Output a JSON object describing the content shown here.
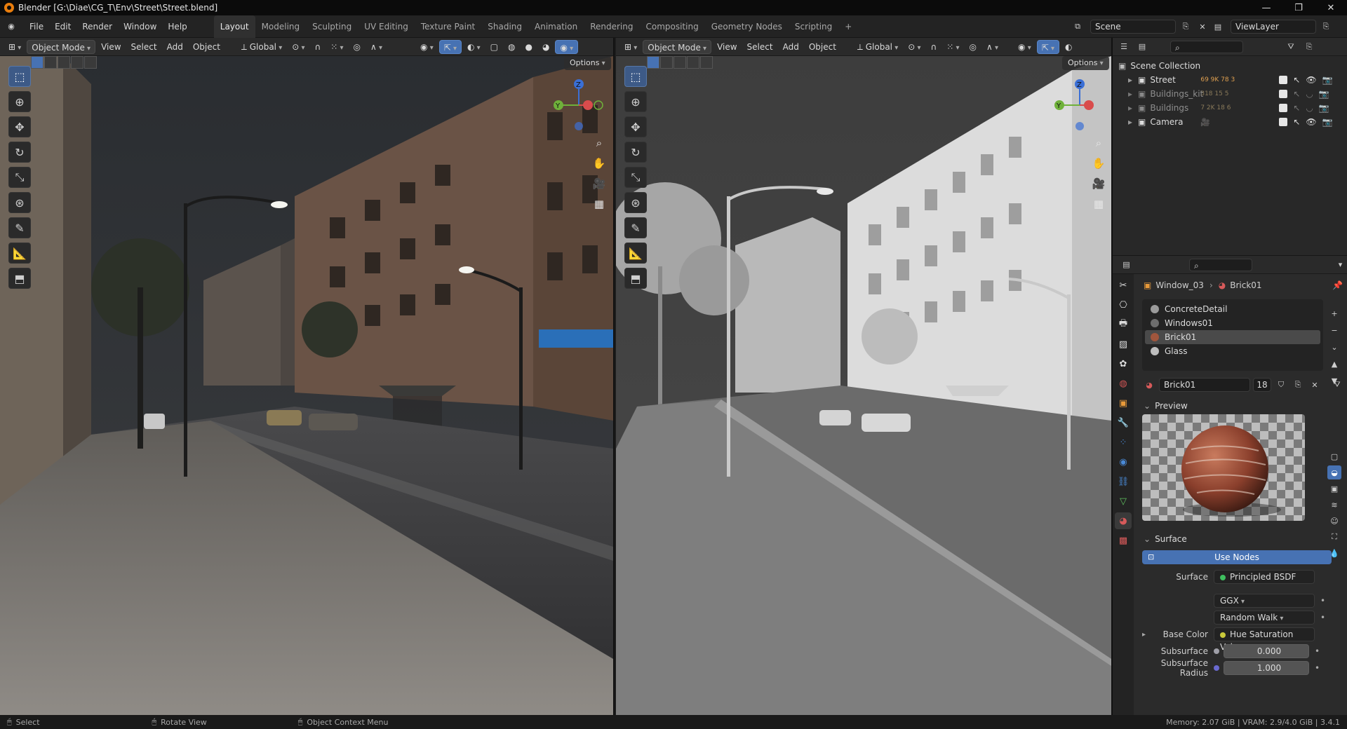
{
  "window": {
    "title": "Blender [G:\\Diae\\CG_T\\Env\\Street\\Street.blend]",
    "minimize": "—",
    "maximize": "❐",
    "close": "✕"
  },
  "menus": [
    "File",
    "Edit",
    "Render",
    "Window",
    "Help"
  ],
  "workspaces": [
    "Layout",
    "Modeling",
    "Sculpting",
    "UV Editing",
    "Texture Paint",
    "Shading",
    "Animation",
    "Rendering",
    "Compositing",
    "Geometry Nodes",
    "Scripting"
  ],
  "workspace_add": "+",
  "scene": {
    "label": "Scene",
    "viewlayer": "ViewLayer"
  },
  "viewport_header": {
    "mode": "Object Mode",
    "view": "View",
    "select": "Select",
    "add": "Add",
    "object": "Object",
    "orientation": "Global",
    "options": "Options"
  },
  "gizmo": {
    "z": "Z",
    "y": "Y"
  },
  "outliner": {
    "root": "Scene Collection",
    "items": [
      {
        "name": "Street",
        "stats": "69 9K 78 3",
        "dim": false
      },
      {
        "name": "Buildings_kit",
        "stats": "318 15 5",
        "dim": true
      },
      {
        "name": "Buildings",
        "stats": "7 2K 18 6",
        "dim": true
      },
      {
        "name": "Camera",
        "stats": "",
        "dim": false
      }
    ]
  },
  "properties": {
    "breadcrumb_object": "Window_03",
    "breadcrumb_material": "Brick01",
    "slots": [
      {
        "name": "ConcreteDetail",
        "color": "#9a9a9a"
      },
      {
        "name": "Windows01",
        "color": "#6e6e6e"
      },
      {
        "name": "Brick01",
        "color": "#a0563d"
      },
      {
        "name": "Glass",
        "color": "#bdbdbd"
      }
    ],
    "selected_slot": 2,
    "material_name": "Brick01",
    "users": "18",
    "preview_label": "Preview",
    "surface_label": "Surface",
    "use_nodes": "Use Nodes",
    "rows": [
      {
        "label": "Surface",
        "value": "Principled BSDF",
        "dot": "#3fbf5f"
      },
      {
        "label": "",
        "value": "GGX",
        "dot": ""
      },
      {
        "label": "",
        "value": "Random Walk",
        "dot": ""
      },
      {
        "label": "Base Color",
        "value": "Hue Saturation Value",
        "dot": "#c9c93a"
      },
      {
        "label": "Subsurface",
        "value": "0.000",
        "dot": "#9f9fa8"
      },
      {
        "label": "Subsurface Radius",
        "value": "1.000",
        "dot": "#6a6ad0"
      }
    ]
  },
  "status": {
    "select": "Select",
    "rotate": "Rotate View",
    "context": "Object Context Menu",
    "memory": "Memory: 2.07 GiB | VRAM: 2.9/4.0 GiB | 3.4.1"
  },
  "colors": {
    "accent": "#4772b3",
    "active_tool": "#3d5a87",
    "bg": "#1d1d1d"
  }
}
